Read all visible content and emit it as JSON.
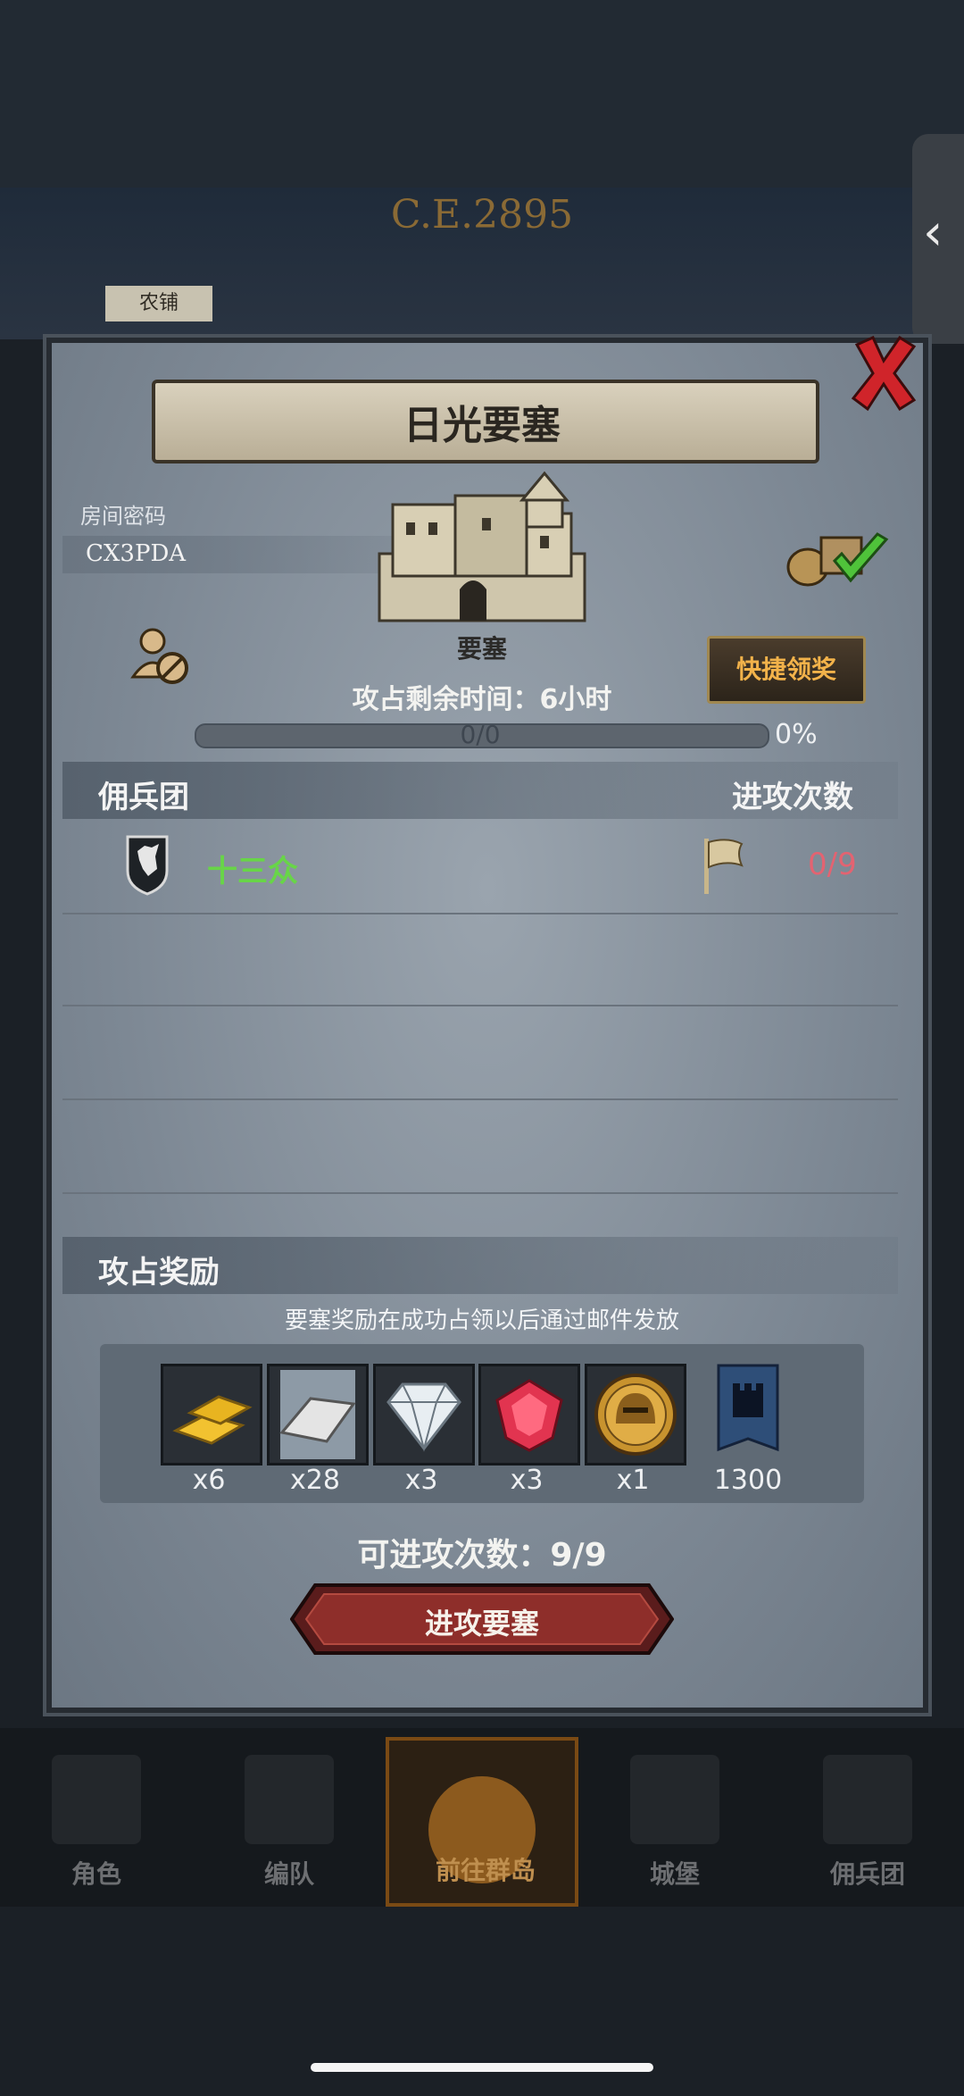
{
  "header": {
    "year": "C.E.2895",
    "farmer_tag": "农铺"
  },
  "dialog": {
    "title": "日光要塞",
    "room_code_label": "房间密码",
    "room_code_value": "CX3PDA",
    "fortress_label": "要塞",
    "quick_claim_label": "快捷领奖",
    "time_remaining": "攻占剩余时间：6小时",
    "progress_text": "0/0",
    "progress_percent": "0%",
    "progress_fraction": 0
  },
  "mercenary_section": {
    "heading": "佣兵团",
    "attacks_heading": "进攻次数",
    "guilds": [
      {
        "name": "十三众",
        "attacks": "0/9"
      }
    ]
  },
  "rewards": {
    "heading": "攻占奖励",
    "note": "要塞奖励在成功占领以后通过邮件发放",
    "items": [
      {
        "icon": "gold-bar-icon",
        "qty": "x6"
      },
      {
        "icon": "silver-bar-icon",
        "qty": "x28"
      },
      {
        "icon": "diamond-icon",
        "qty": "x3"
      },
      {
        "icon": "ruby-icon",
        "qty": "x3"
      },
      {
        "icon": "helmet-coin-icon",
        "qty": "x1"
      },
      {
        "icon": "castle-medal-icon",
        "qty": "1300"
      }
    ],
    "attacks_available": "可进攻次数：9/9",
    "attack_button_label": "进攻要塞"
  },
  "bottom_nav": [
    {
      "label": "角色",
      "icon": "knight-icon"
    },
    {
      "label": "编队",
      "icon": "formation-icon"
    },
    {
      "label": "前往群岛",
      "icon": "islands-icon"
    },
    {
      "label": "城堡",
      "icon": "castle-icon"
    },
    {
      "label": "佣兵团",
      "icon": "mercenary-icon"
    }
  ],
  "colors": {
    "accent_gold": "#f2b24a",
    "guild_green": "#68d548",
    "attacks_red": "#e36371"
  }
}
